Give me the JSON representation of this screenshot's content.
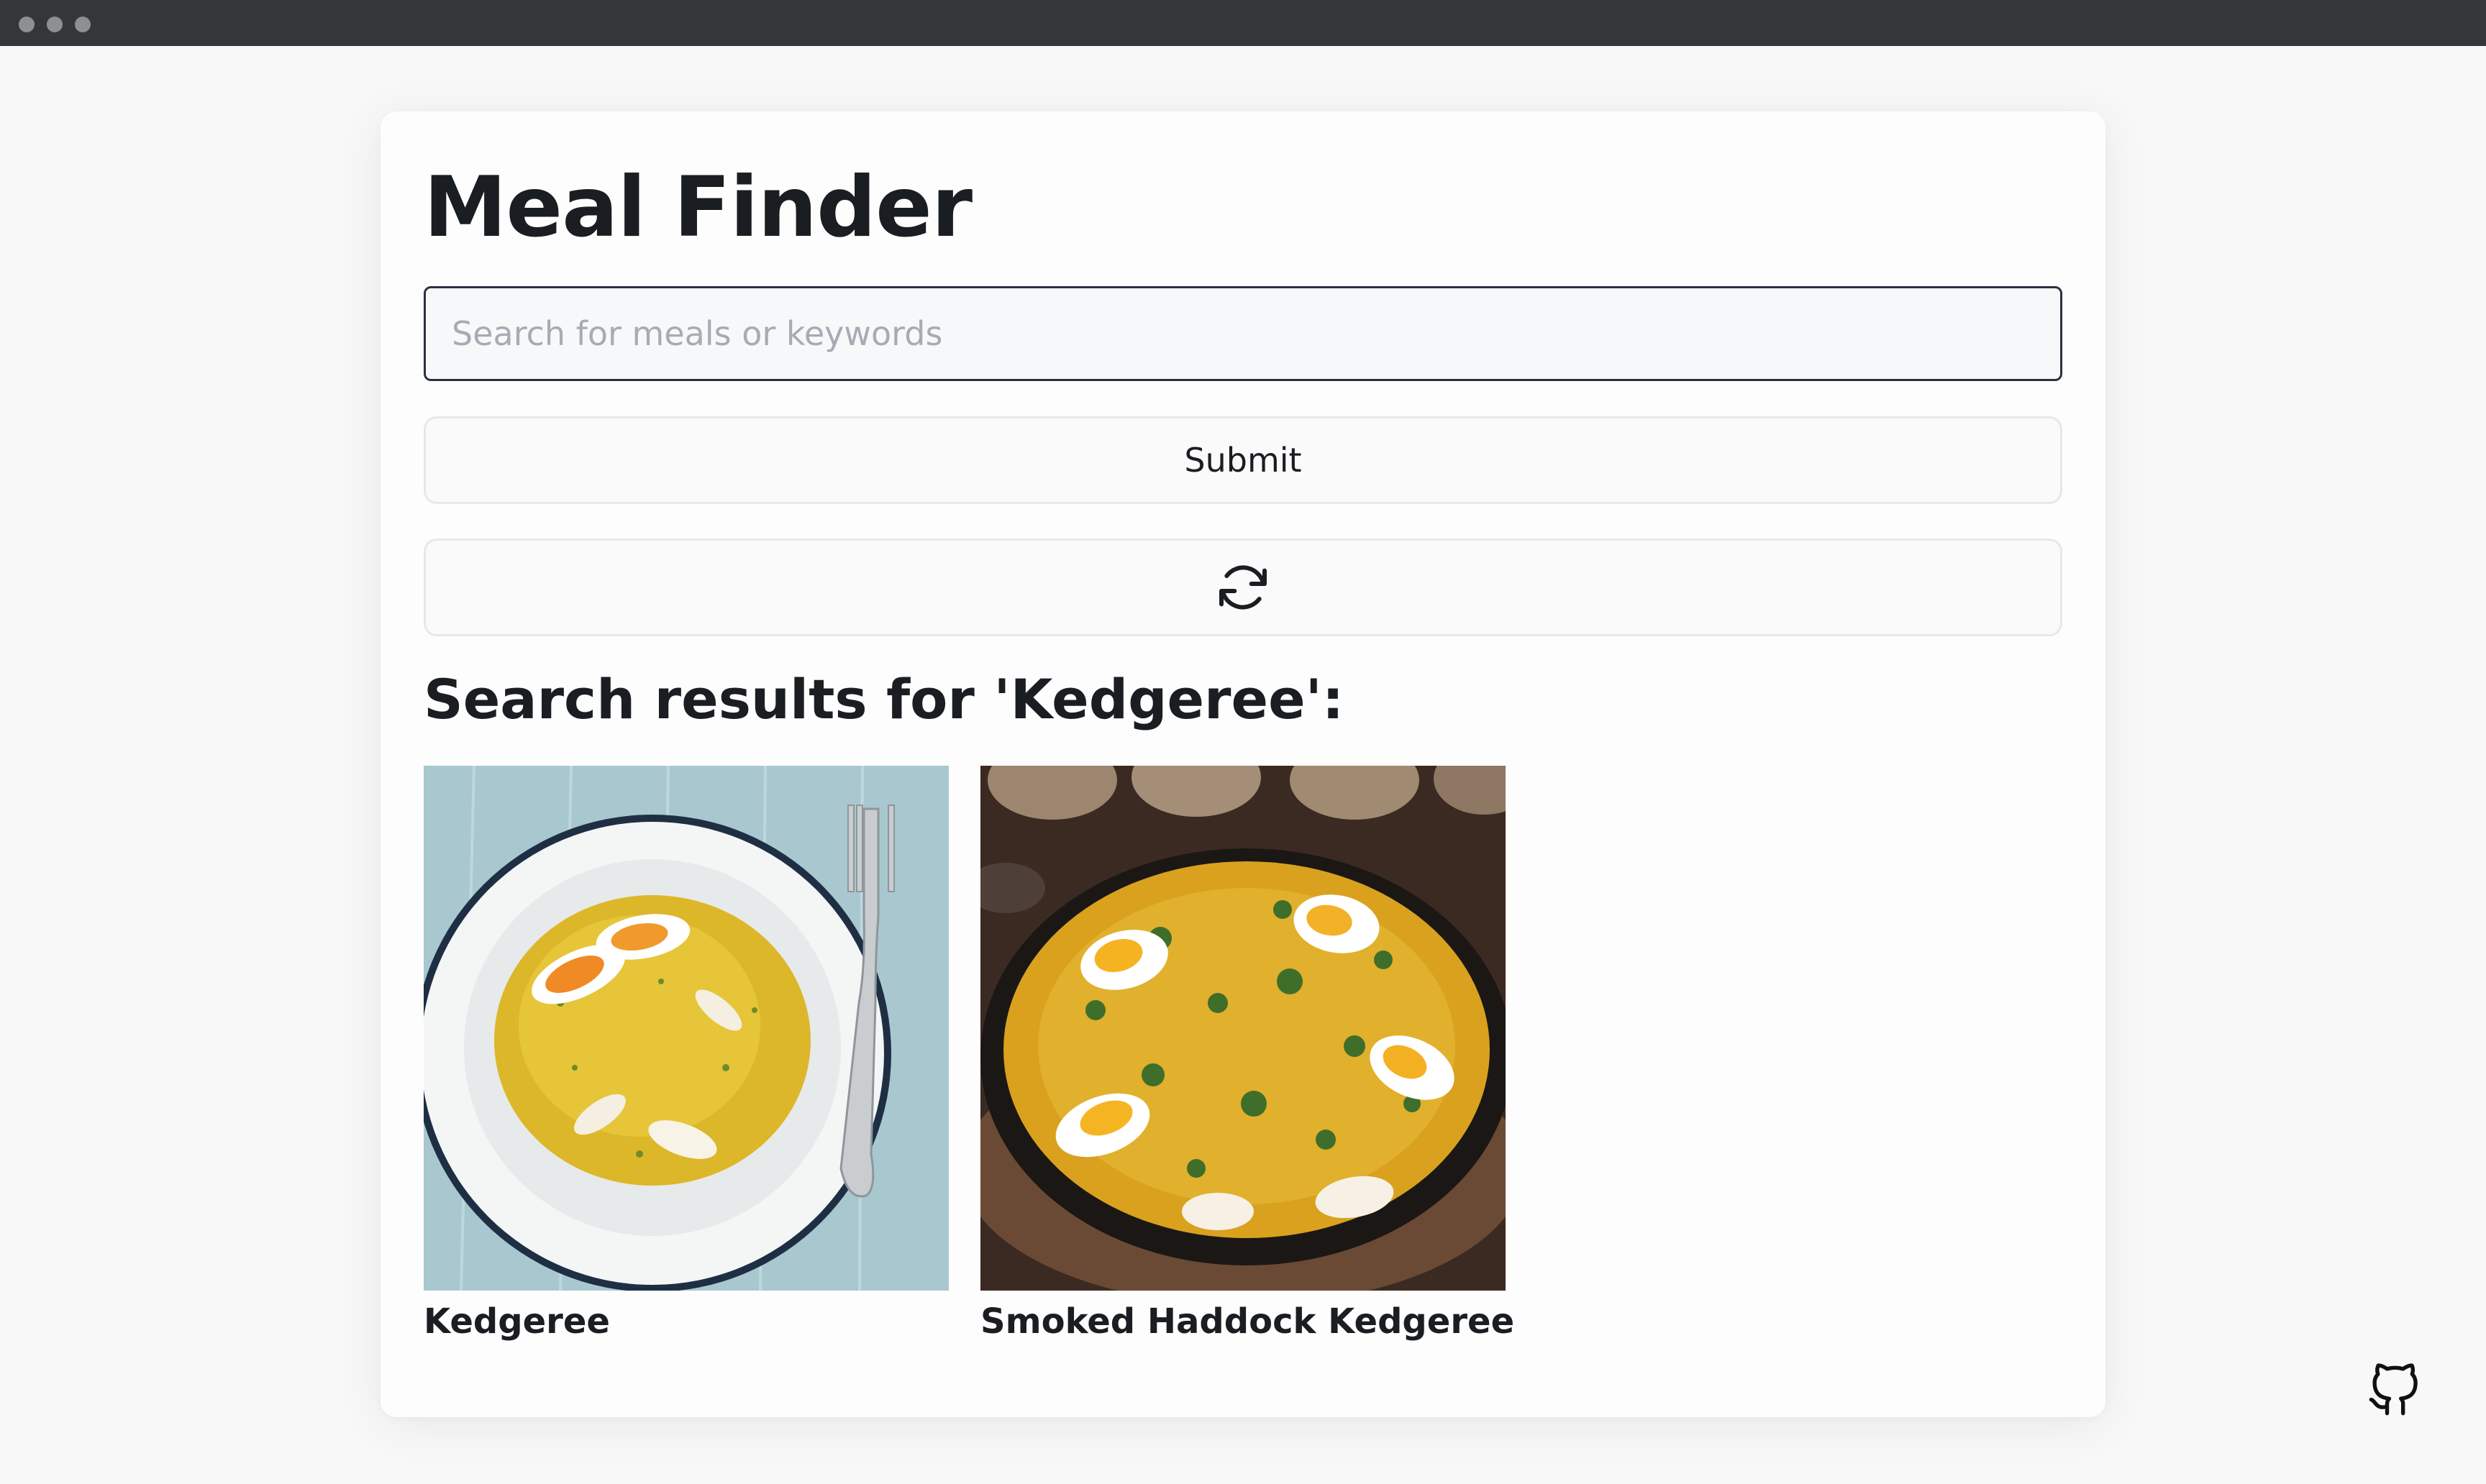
{
  "window": {
    "traffic_lights": [
      "close",
      "minimize",
      "zoom"
    ]
  },
  "app": {
    "title": "Meal Finder"
  },
  "search": {
    "placeholder": "Search for meals or keywords",
    "value": ""
  },
  "buttons": {
    "submit_label": "Submit",
    "refresh_icon": "refresh-icon"
  },
  "results": {
    "heading": "Search results for 'Kedgeree':",
    "meals": [
      {
        "name": "Kedgeree",
        "image": "kedgeree-plate-photo"
      },
      {
        "name": "Smoked Haddock Kedgeree",
        "image": "kedgeree-pan-photo"
      }
    ]
  },
  "footer": {
    "icon": "github-icon"
  },
  "colors": {
    "background": "#f8f8f8",
    "card": "#fdfdfd",
    "text": "#1a1d21",
    "titlebar": "#353638",
    "input_border": "#2a3240",
    "button_border": "#e7e8ea"
  }
}
